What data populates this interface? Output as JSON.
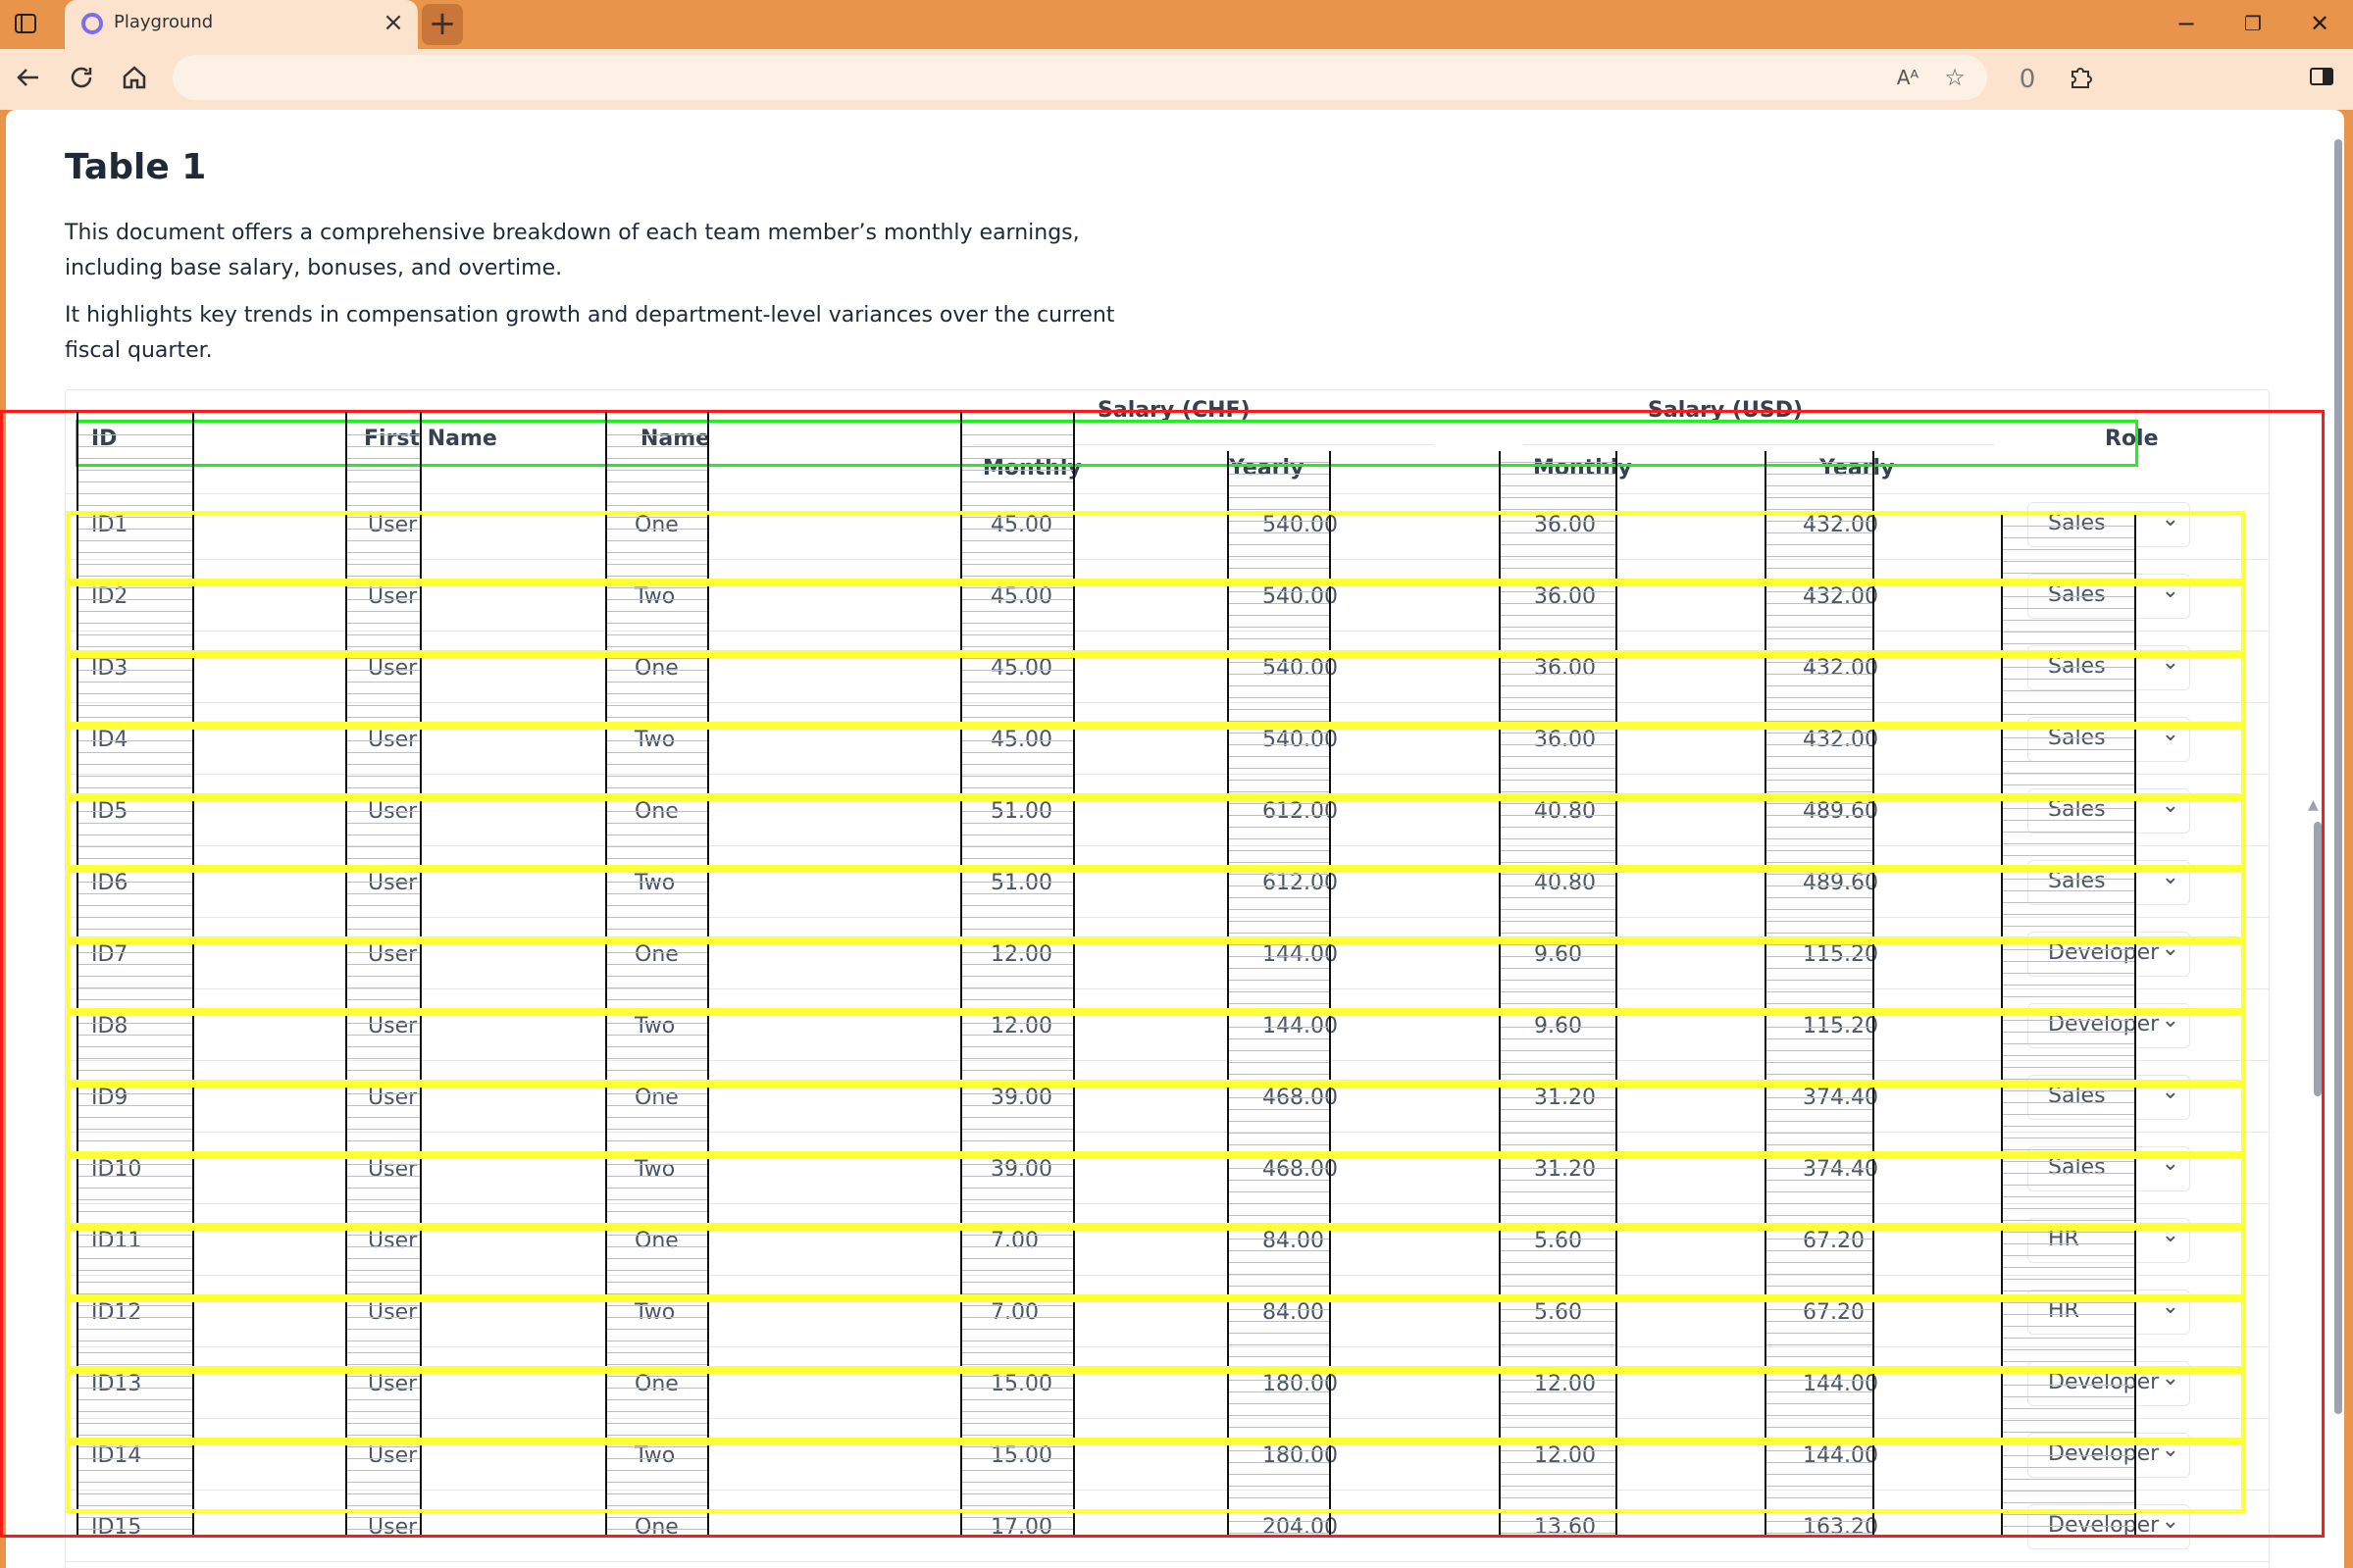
{
  "browser": {
    "tab_title": "Playground",
    "tab_close": "×",
    "new_tab": "+",
    "window_controls": {
      "minimize": "−",
      "restore": "❐",
      "close": "✕"
    },
    "address": "",
    "icons": [
      "sidebar-toggle-icon",
      "back-icon",
      "reload-icon",
      "home-icon",
      "read-aloud-icon",
      "favorites-star-icon",
      "tracking-prevention-icon",
      "extensions-icon",
      "split-screen-icon"
    ]
  },
  "page": {
    "title": "Table 1",
    "description": [
      "This document offers a comprehensive breakdown of each team member’s monthly earnings, including base salary, bonuses, and overtime.",
      "It highlights key trends in compensation growth and department-level variances over the current fiscal quarter."
    ]
  },
  "table": {
    "headers": {
      "id": "ID",
      "first_name": "First Name",
      "name": "Name",
      "salary_chf": "Salary (CHF)",
      "salary_usd": "Salary (USD)",
      "monthly": "Monthly",
      "yearly": "Yearly",
      "role": "Role"
    },
    "rows": [
      {
        "id": "ID1",
        "first": "User",
        "name": "One",
        "chf_m": "45.00",
        "chf_y": "540.00",
        "usd_m": "36.00",
        "usd_y": "432.00",
        "role": "Sales"
      },
      {
        "id": "ID2",
        "first": "User",
        "name": "Two",
        "chf_m": "45.00",
        "chf_y": "540.00",
        "usd_m": "36.00",
        "usd_y": "432.00",
        "role": "Sales"
      },
      {
        "id": "ID3",
        "first": "User",
        "name": "One",
        "chf_m": "45.00",
        "chf_y": "540.00",
        "usd_m": "36.00",
        "usd_y": "432.00",
        "role": "Sales"
      },
      {
        "id": "ID4",
        "first": "User",
        "name": "Two",
        "chf_m": "45.00",
        "chf_y": "540.00",
        "usd_m": "36.00",
        "usd_y": "432.00",
        "role": "Sales"
      },
      {
        "id": "ID5",
        "first": "User",
        "name": "One",
        "chf_m": "51.00",
        "chf_y": "612.00",
        "usd_m": "40.80",
        "usd_y": "489.60",
        "role": "Sales"
      },
      {
        "id": "ID6",
        "first": "User",
        "name": "Two",
        "chf_m": "51.00",
        "chf_y": "612.00",
        "usd_m": "40.80",
        "usd_y": "489.60",
        "role": "Sales"
      },
      {
        "id": "ID7",
        "first": "User",
        "name": "One",
        "chf_m": "12.00",
        "chf_y": "144.00",
        "usd_m": "9.60",
        "usd_y": "115.20",
        "role": "Developer"
      },
      {
        "id": "ID8",
        "first": "User",
        "name": "Two",
        "chf_m": "12.00",
        "chf_y": "144.00",
        "usd_m": "9.60",
        "usd_y": "115.20",
        "role": "Developer"
      },
      {
        "id": "ID9",
        "first": "User",
        "name": "One",
        "chf_m": "39.00",
        "chf_y": "468.00",
        "usd_m": "31.20",
        "usd_y": "374.40",
        "role": "Sales"
      },
      {
        "id": "ID10",
        "first": "User",
        "name": "Two",
        "chf_m": "39.00",
        "chf_y": "468.00",
        "usd_m": "31.20",
        "usd_y": "374.40",
        "role": "Sales"
      },
      {
        "id": "ID11",
        "first": "User",
        "name": "One",
        "chf_m": "7.00",
        "chf_y": "84.00",
        "usd_m": "5.60",
        "usd_y": "67.20",
        "role": "HR"
      },
      {
        "id": "ID12",
        "first": "User",
        "name": "Two",
        "chf_m": "7.00",
        "chf_y": "84.00",
        "usd_m": "5.60",
        "usd_y": "67.20",
        "role": "HR"
      },
      {
        "id": "ID13",
        "first": "User",
        "name": "One",
        "chf_m": "15.00",
        "chf_y": "180.00",
        "usd_m": "12.00",
        "usd_y": "144.00",
        "role": "Developer"
      },
      {
        "id": "ID14",
        "first": "User",
        "name": "Two",
        "chf_m": "15.00",
        "chf_y": "180.00",
        "usd_m": "12.00",
        "usd_y": "144.00",
        "role": "Developer"
      },
      {
        "id": "ID15",
        "first": "User",
        "name": "One",
        "chf_m": "17.00",
        "chf_y": "204.00",
        "usd_m": "13.60",
        "usd_y": "163.20",
        "role": "Developer"
      }
    ]
  },
  "colors": {
    "browser_frame": "#e8944a",
    "tab_active": "#fbe3cd",
    "overlay_red": "#ff1a1a",
    "overlay_green": "#22ee22",
    "overlay_yellow": "#ffff33"
  }
}
